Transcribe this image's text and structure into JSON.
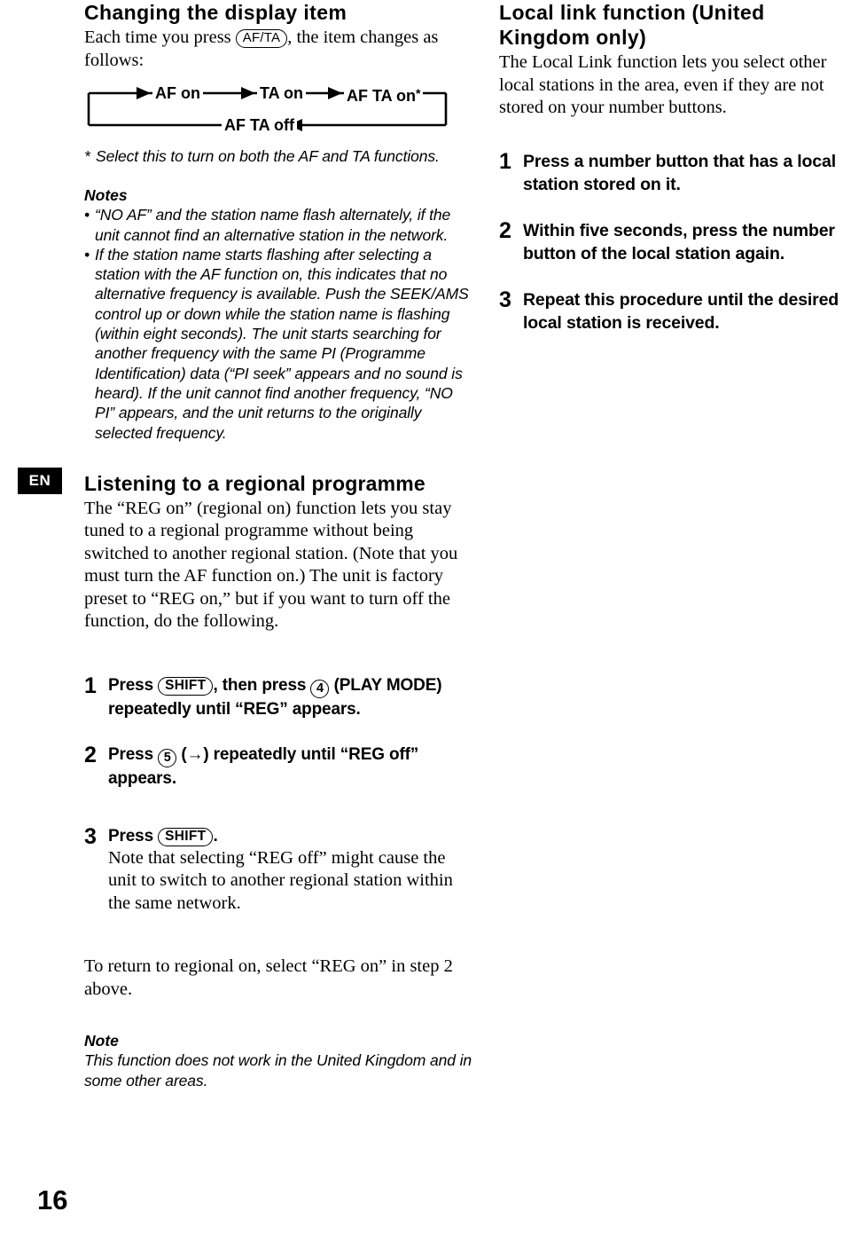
{
  "page": {
    "number": "16",
    "language_tab": "EN"
  },
  "left_column": {
    "section_title": "Changing the display item",
    "intro_before_key": "Each time you press",
    "intro_key": "AF/TA",
    "intro_after_key": ", the item changes as follows:",
    "flow": {
      "top_items": [
        "AF on",
        "TA on",
        "AF TA on"
      ],
      "top_last_star": "*",
      "bottom_item": "AF TA off"
    },
    "footnote_mark": "*",
    "footnote_text": "Select this to turn on both the AF and TA functions.",
    "notes_label": "Notes",
    "notes": [
      "“NO AF” and the station name flash alternately, if the unit cannot find an alternative station in the network.",
      "If the station name starts flashing after selecting a station with the AF function on, this indicates that no alternative frequency is available. Push the SEEK/AMS control up or down while the station name is flashing (within eight seconds). The unit starts searching for another frequency with the same PI (Programme Identification) data (“PI seek” appears and no sound is heard). If the unit cannot find another frequency, “NO PI” appears, and the unit returns to the originally selected frequency."
    ],
    "regional": {
      "title": "Listening to a regional programme",
      "body": "The “REG on” (regional on) function lets you stay tuned to a regional programme without being switched to another regional station. (Note that you must turn the AF function on.) The unit is factory preset to “REG on,” but if you want to turn off the function, do the following."
    },
    "steps": [
      {
        "number": "1",
        "seg1": "Press",
        "key1": "SHIFT",
        "seg2": ", then press",
        "key2": "4",
        "seg3": "(PLAY MODE) repeatedly until “REG” appears."
      },
      {
        "number": "2",
        "seg1": "Press",
        "key1": "5",
        "seg2": "(→) repeatedly until “REG off” appears."
      },
      {
        "number": "3",
        "seg1": "Press",
        "key1": "SHIFT",
        "seg2": ".",
        "sub_text": "Note that selecting “REG off” might cause the unit to switch to another regional station within the same network."
      }
    ],
    "closing_text": "To return to regional on, select “REG on” in step 2 above.",
    "note_label": "Note",
    "note_text": "This function does not work in the United Kingdom and in some other areas."
  },
  "right_column": {
    "section_title": "Local link function (United Kingdom only)",
    "body": "The Local Link function lets you select other local stations in the area, even if they are not stored on your number buttons.",
    "steps": [
      {
        "number": "1",
        "text": "Press a number button that has a local station stored on it."
      },
      {
        "number": "2",
        "text": "Within five seconds, press the number button of the local station again."
      },
      {
        "number": "3",
        "text": "Repeat this procedure until the desired local station is received."
      }
    ]
  }
}
